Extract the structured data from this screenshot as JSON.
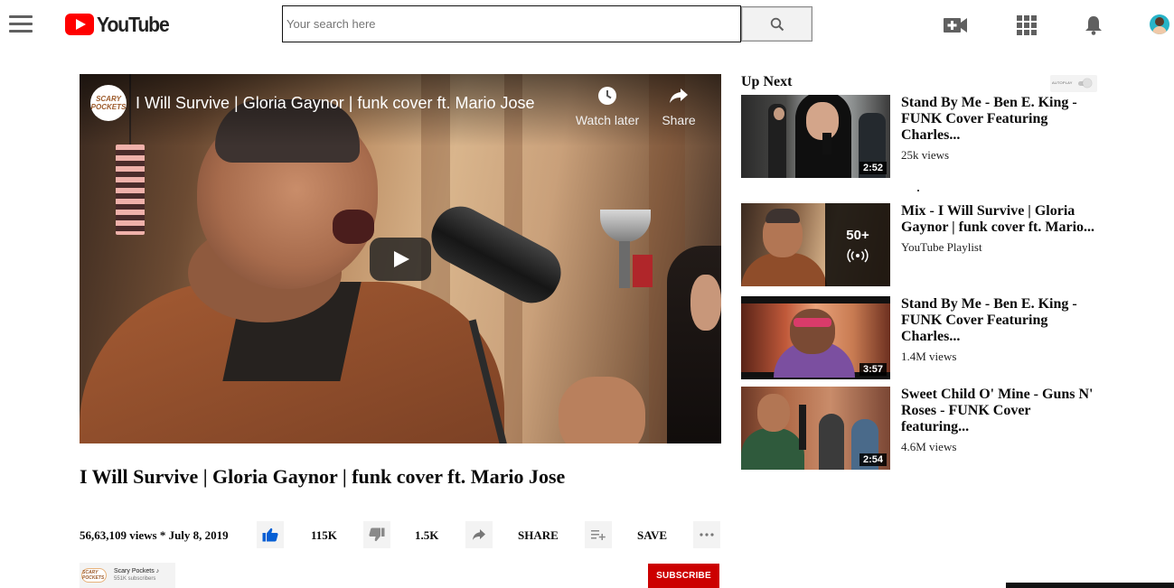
{
  "header": {
    "logo_text": "YouTube",
    "search_placeholder": "Your search here",
    "icons": [
      "menu-icon",
      "youtube-logo-icon",
      "search-icon",
      "video-camera-add-icon",
      "apps-grid-icon",
      "bell-icon",
      "avatar"
    ]
  },
  "player": {
    "channel_bubble": "SCARY POCKETS",
    "title": "I Will Survive | Gloria Gaynor | funk cover ft. Mario Jose",
    "watch_later_label": "Watch later",
    "share_label": "Share"
  },
  "video": {
    "title": "I Will Survive | Gloria Gaynor | funk cover ft. Mario Jose",
    "meta": "56,63,109 views * July 8, 2019",
    "likes": "115K",
    "dislikes": "1.5K",
    "share_label": "SHARE",
    "save_label": "SAVE"
  },
  "channel": {
    "logo_text": "SCARY POCKETS",
    "name": "Scary Pockets ♪",
    "subscribers": "551K subscribers",
    "subscribe_label": "SUBSCRIBE"
  },
  "up_next": {
    "heading": "Up Next",
    "autoplay_label": "AUTOPLAY",
    "autoplay_on": false,
    "items": [
      {
        "title": "Stand By Me - Ben E. King - FUNK Cover Featuring Charles...",
        "sub": "25k views",
        "duration": "2:52"
      },
      {
        "title": "Mix - I Will Survive | Gloria Gaynor | funk cover ft. Mario...",
        "sub": "YouTube Playlist",
        "count": "50+"
      },
      {
        "title": "Stand By Me - Ben E. King - FUNK Cover Featuring Charles...",
        "sub": "1.4M views",
        "duration": "3:57"
      },
      {
        "title": "Sweet Child O' Mine - Guns N' Roses - FUNK Cover featuring...",
        "sub": "4.6M views",
        "duration": "2:54"
      }
    ]
  },
  "colors": {
    "brand_red": "#ff0000",
    "subscribe_red": "#cc0000",
    "like_blue": "#065fd4",
    "icon_gray": "#606060"
  }
}
